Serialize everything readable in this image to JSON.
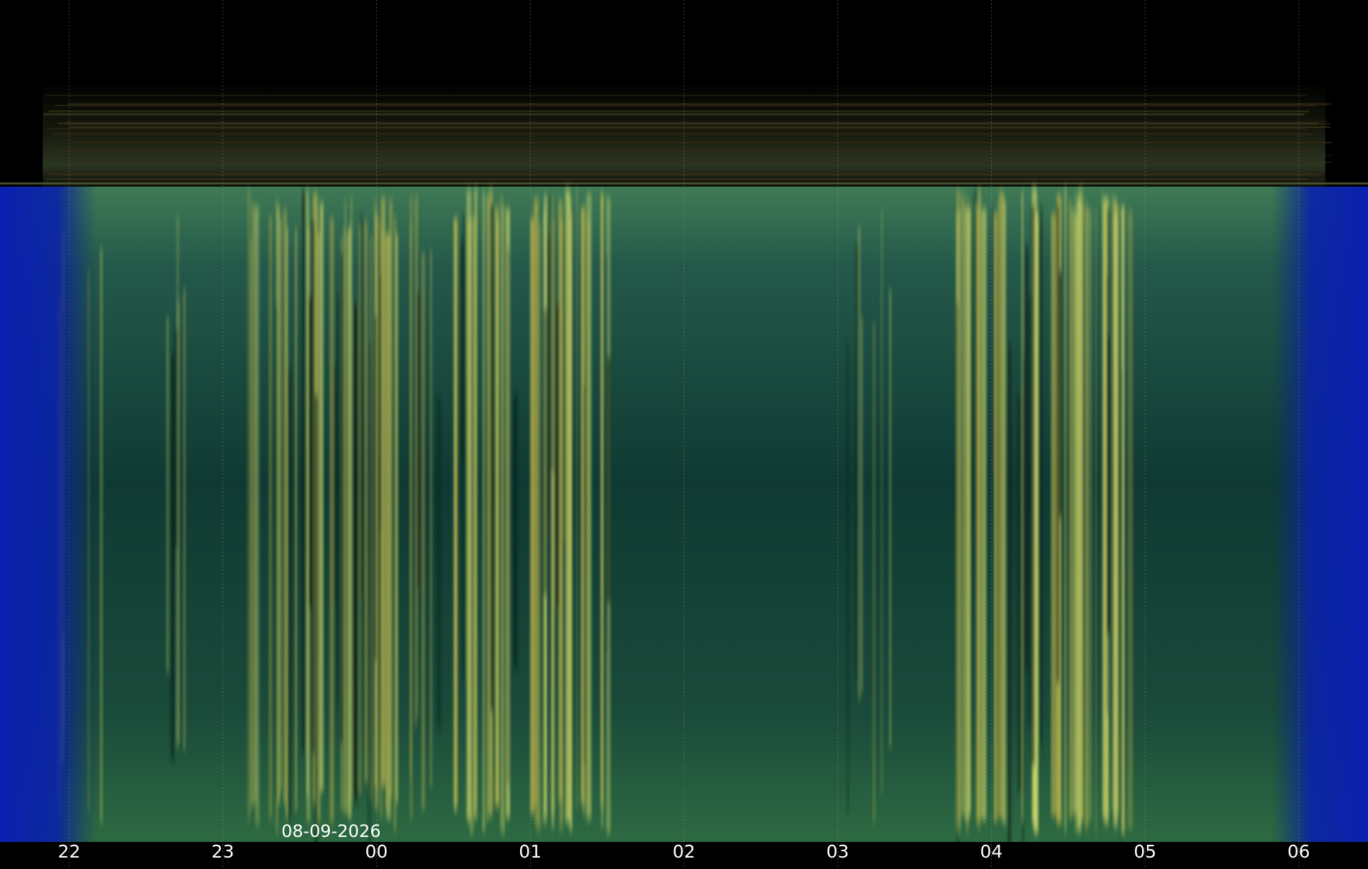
{
  "chart_data": {
    "type": "heatmap",
    "title": "",
    "xlabel": "",
    "ylabel": "",
    "date_label": "08-09-2026",
    "x_axis": {
      "unit": "hour of night",
      "range_hours": [
        21.55,
        6.45
      ],
      "tick_labels": [
        "22",
        "23",
        "00",
        "01",
        "02",
        "03",
        "04",
        "05",
        "06"
      ],
      "grid": true
    },
    "aurora_bursts": [
      {
        "start": "21:55",
        "end": "22:15",
        "intensity": 0.45
      },
      {
        "start": "22:35",
        "end": "22:45",
        "intensity": 0.35
      },
      {
        "start": "23:05",
        "end": "00:10",
        "intensity": 0.85
      },
      {
        "start": "00:10",
        "end": "00:25",
        "intensity": 0.55
      },
      {
        "start": "00:30",
        "end": "01:30",
        "intensity": 0.95
      },
      {
        "start": "03:00",
        "end": "03:25",
        "intensity": 0.3
      },
      {
        "start": "03:45",
        "end": "04:55",
        "intensity": 1.0
      }
    ],
    "colors": {
      "twilight": "#0a2ec8",
      "sky": "#123d32",
      "aurora": "#b8b04a",
      "aurora_bright": "#c9d36a",
      "top_band": "#2b3520"
    }
  }
}
